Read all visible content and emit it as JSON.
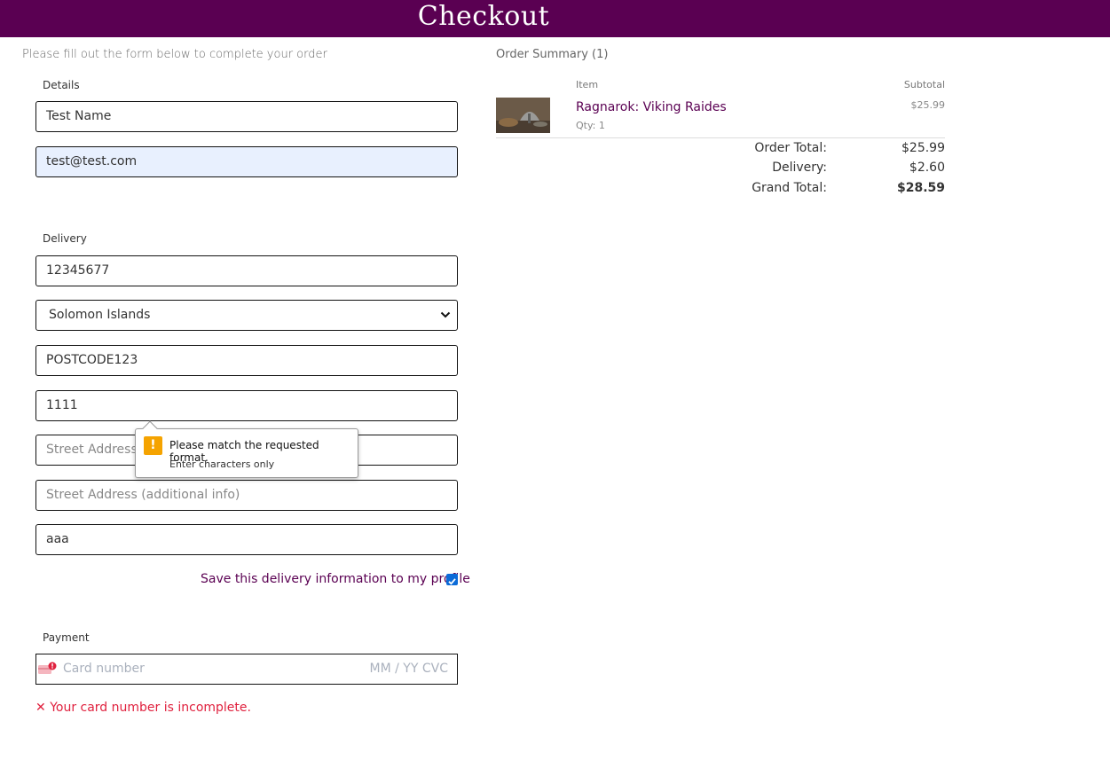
{
  "header": {
    "title": "Checkout"
  },
  "form": {
    "intro": "Please fill out the form below to complete your order",
    "details_label": "Details",
    "full_name": "Test Name",
    "email": "test@test.com",
    "delivery_label": "Delivery",
    "phone": "12345677",
    "country": "Solomon Islands",
    "postcode": "POSTCODE123",
    "town": "1111",
    "street1_placeholder": "Street Address 1",
    "street2_placeholder": "Street Address (additional info)",
    "county": "aaa",
    "save_label": "Save this delivery information to my profile",
    "save_checked": true,
    "payment_label": "Payment",
    "card_placeholder": "Card number",
    "card_expiry_cvc": "MM / YY  CVC",
    "card_error": "Your card number is incomplete."
  },
  "validation_tooltip": {
    "title": "Please match the requested format.",
    "subtitle": "Enter characters only"
  },
  "summary": {
    "title": "Order Summary (1)",
    "col_item": "Item",
    "col_subtotal": "Subtotal",
    "items": [
      {
        "name": "Ragnarok: Viking Raides",
        "qty": "Qty: 1",
        "subtotal": "$25.99"
      }
    ],
    "order_total_label": "Order Total:",
    "order_total": "$25.99",
    "delivery_label": "Delivery:",
    "delivery": "$2.60",
    "grand_total_label": "Grand Total:",
    "grand_total": "$28.59"
  },
  "colors": {
    "brand": "#5a0052",
    "error": "#e0213e",
    "autofill": "#e8f0fe",
    "warning": "#f5a300"
  }
}
